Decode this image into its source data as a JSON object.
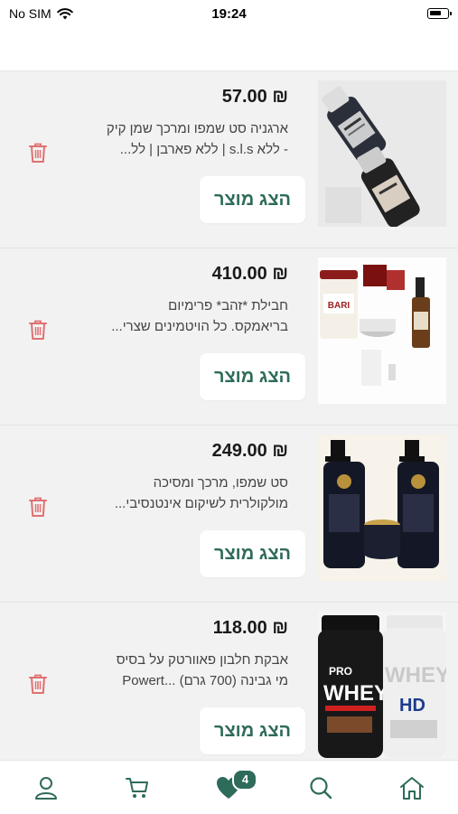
{
  "status": {
    "carrier": "No SIM",
    "time": "19:24"
  },
  "products": [
    {
      "price": "₪ 57.00",
      "line1": "ארגניה סט שמפו ומרכך שמן קיק",
      "line2": "- ללא s.l.s | ללא פארבן | לל...",
      "button": "הצג מוצר"
    },
    {
      "price": "₪ 410.00",
      "line1": "חבילת *זהב* פרימיום",
      "line2": "בריאמקס. כל הויטמינים שצרי...",
      "button": "הצג מוצר"
    },
    {
      "price": "₪ 249.00",
      "line1": "סט שמפו, מרכך ומסיכה",
      "line2": "מולקולרית לשיקום אינטנסיבי...",
      "button": "הצג מוצר"
    },
    {
      "price": "₪ 118.00",
      "line1": "אבקת חלבון פאוורטק על בסיס",
      "line2": "מי גבינה (700 גרם) ...Powert",
      "button": "הצג מוצר"
    }
  ],
  "thumb_labels": {
    "box_brand": "BARI",
    "whey1": "WHEY",
    "whey2": "WHEY",
    "whey1_top": "PRO",
    "whey2_bottom": "HD"
  },
  "tabs": {
    "favorites_badge": "4"
  },
  "colors": {
    "accent": "#2e6b5a",
    "delete": "#e07070"
  }
}
